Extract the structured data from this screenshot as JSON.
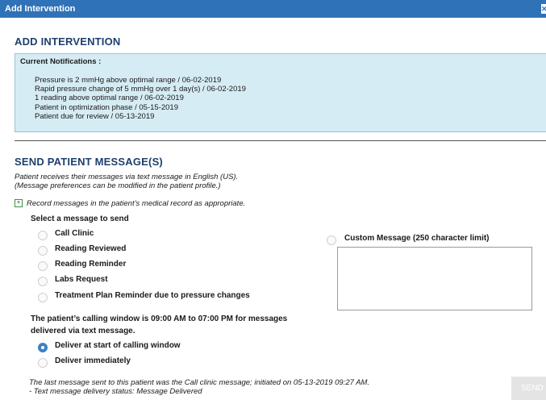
{
  "window": {
    "title": "Add Intervention"
  },
  "add_intervention": {
    "heading": "ADD INTERVENTION",
    "notifications_title": "Current Notifications :",
    "notifications": [
      "Pressure is 2 mmHg above optimal range / 06-02-2019",
      "Rapid pressure change of 5 mmHg over 1 day(s) / 06-02-2019",
      "1 reading above optimal range / 06-02-2019",
      "Patient in optimization phase / 05-15-2019",
      "Patient due for review / 05-13-2019"
    ]
  },
  "send_messages": {
    "heading": "SEND PATIENT MESSAGE(S)",
    "info_line1": "Patient receives their messages via text message in English (US).",
    "info_line2": "(Message preferences can be modified in the patient profile.)",
    "record_note": "Record messages in the patient’s medical record as appropriate.",
    "select_label": "Select a message to send",
    "options": [
      "Call Clinic",
      "Reading Reviewed",
      "Reading Reminder",
      "Labs Request",
      "Treatment Plan Reminder due to pressure changes"
    ],
    "custom_label": "Custom Message (250 character limit)",
    "calling_window_line1": "The patient’s calling window is 09:00 AM to 07:00 PM for messages",
    "calling_window_line2": "delivered via text message.",
    "delivery_options": [
      {
        "label": "Deliver at start of calling window",
        "selected": true
      },
      {
        "label": "Deliver immediately",
        "selected": false
      }
    ],
    "last_message_line1": "The last message sent to this patient was the Call clinic message; initiated on 05-13-2019 09:27 AM.",
    "last_message_line2": "- Text message delivery status: Message Delivered",
    "send_label": "SEND"
  },
  "colors": {
    "titlebar": "#2f72b8",
    "heading": "#1d3f6e",
    "notification_bg": "#d6ecf4",
    "radio_selected": "#3b82c8"
  }
}
